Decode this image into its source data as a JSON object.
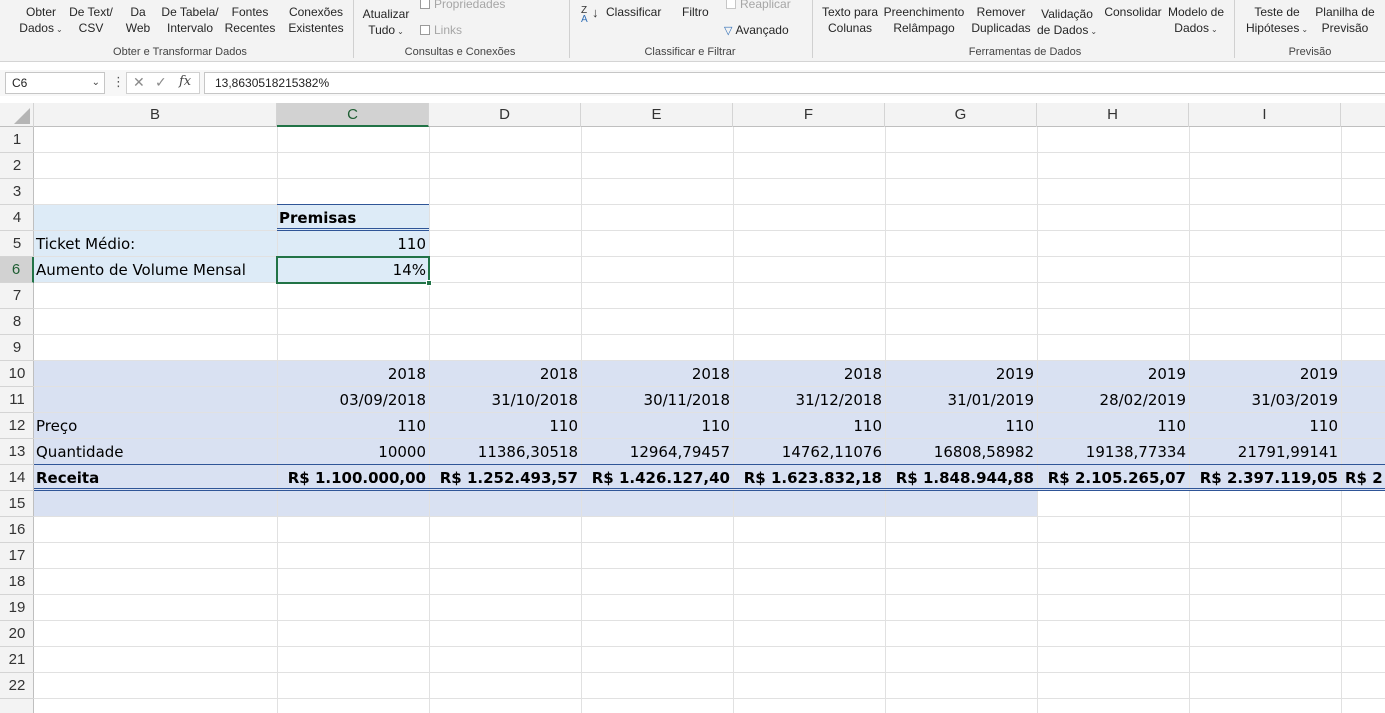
{
  "ribbon": {
    "buttons": [
      {
        "name": "obter-dados-button",
        "l1": "Obter",
        "l2": "Dados",
        "dropdown": true,
        "interactable": true
      },
      {
        "name": "de-text-csv-button",
        "l1": "De Text/",
        "l2": "CSV",
        "dropdown": false,
        "interactable": true
      },
      {
        "name": "da-web-button",
        "l1": "Da",
        "l2": "Web",
        "dropdown": false,
        "interactable": true
      },
      {
        "name": "de-tabela-intervalo-button",
        "l1": "De Tabela/",
        "l2": "Intervalo",
        "dropdown": false,
        "interactable": true
      },
      {
        "name": "fontes-recentes-button",
        "l1": "Fontes",
        "l2": "Recentes",
        "dropdown": false,
        "interactable": true
      },
      {
        "name": "conexoes-existentes-button",
        "l1": "Conexões",
        "l2": "Existentes",
        "dropdown": false,
        "interactable": true
      },
      {
        "name": "atualizar-tudo-button",
        "l1": "Atualizar",
        "l2": "Tudo",
        "dropdown": true,
        "interactable": true
      },
      {
        "name": "texto-para-colunas-button",
        "l1": "Texto para",
        "l2": "Colunas",
        "dropdown": false,
        "interactable": true
      },
      {
        "name": "preenchimento-relampago-button",
        "l1": "Preenchimento",
        "l2": "Relâmpago",
        "dropdown": false,
        "interactable": true
      },
      {
        "name": "remover-duplicadas-button",
        "l1": "Remover",
        "l2": "Duplicadas",
        "dropdown": false,
        "interactable": true
      },
      {
        "name": "validacao-de-dados-button",
        "l1": "Validação",
        "l2": "de Dados",
        "dropdown": true,
        "interactable": true
      },
      {
        "name": "consolidar-button",
        "l1": "Consolidar",
        "l2": "",
        "dropdown": false,
        "interactable": true
      },
      {
        "name": "modelo-de-dados-button",
        "l1": "Modelo de",
        "l2": "Dados",
        "dropdown": true,
        "interactable": true
      },
      {
        "name": "teste-de-hipoteses-button",
        "l1": "Teste de",
        "l2": "Hipóteses",
        "dropdown": true,
        "interactable": true
      },
      {
        "name": "planilha-de-previsao-button",
        "l1": "Planilha de",
        "l2": "Previsão",
        "dropdown": false,
        "interactable": true
      }
    ],
    "propriedades": "Propriedades",
    "links": "Links",
    "classificar": "Classificar",
    "filtro": "Filtro",
    "reaplicar": "Reaplicar",
    "avancado": "Avançado",
    "groups": {
      "obter": "Obter e Transformar Dados",
      "consultas": "Consultas e Conexões",
      "classificar": "Classificar e Filtrar",
      "ferramentas": "Ferramentas de Dados",
      "previsao": "Previsão"
    }
  },
  "formula_bar": {
    "name_box": "C6",
    "fx": "fx",
    "formula": "13,8630518215382%"
  },
  "columns": [
    "B",
    "C",
    "D",
    "E",
    "F",
    "G",
    "H",
    "I"
  ],
  "selected_column": "C",
  "rows": [
    "1",
    "2",
    "3",
    "4",
    "5",
    "6",
    "7",
    "8",
    "9",
    "10",
    "11",
    "12",
    "13",
    "14",
    "15",
    "16",
    "17",
    "18",
    "19",
    "20",
    "21",
    "22"
  ],
  "selected_row": "6",
  "premisas": {
    "header": "Premisas",
    "ticket_label": "Ticket Médio:",
    "ticket_value": "110",
    "aumento_label": "Aumento de Volume Mensal",
    "aumento_value": "14%"
  },
  "table": {
    "years": [
      "2018",
      "2018",
      "2018",
      "2018",
      "2019",
      "2019",
      "2019"
    ],
    "dates": [
      "03/09/2018",
      "31/10/2018",
      "30/11/2018",
      "31/12/2018",
      "31/01/2019",
      "28/02/2019",
      "31/03/2019"
    ],
    "preco_label": "Preço",
    "preco": [
      "110",
      "110",
      "110",
      "110",
      "110",
      "110",
      "110"
    ],
    "quantidade_label": "Quantidade",
    "quantidade": [
      "10000",
      "11386,30518",
      "12964,79457",
      "14762,11076",
      "16808,58982",
      "19138,77334",
      "21791,99141"
    ],
    "receita_label": "Receita",
    "receita": [
      "R$ 1.100.000,00",
      "R$ 1.252.493,57",
      "R$ 1.426.127,40",
      "R$ 1.623.832,18",
      "R$ 1.848.944,88",
      "R$ 2.105.265,07",
      "R$ 2.397.119,05",
      "R$ 2"
    ]
  },
  "colors": {
    "premisas_fill": "#ddebf7",
    "table_fill": "#d9e1f2",
    "selection": "#217346",
    "header_rule": "#2f5597"
  }
}
